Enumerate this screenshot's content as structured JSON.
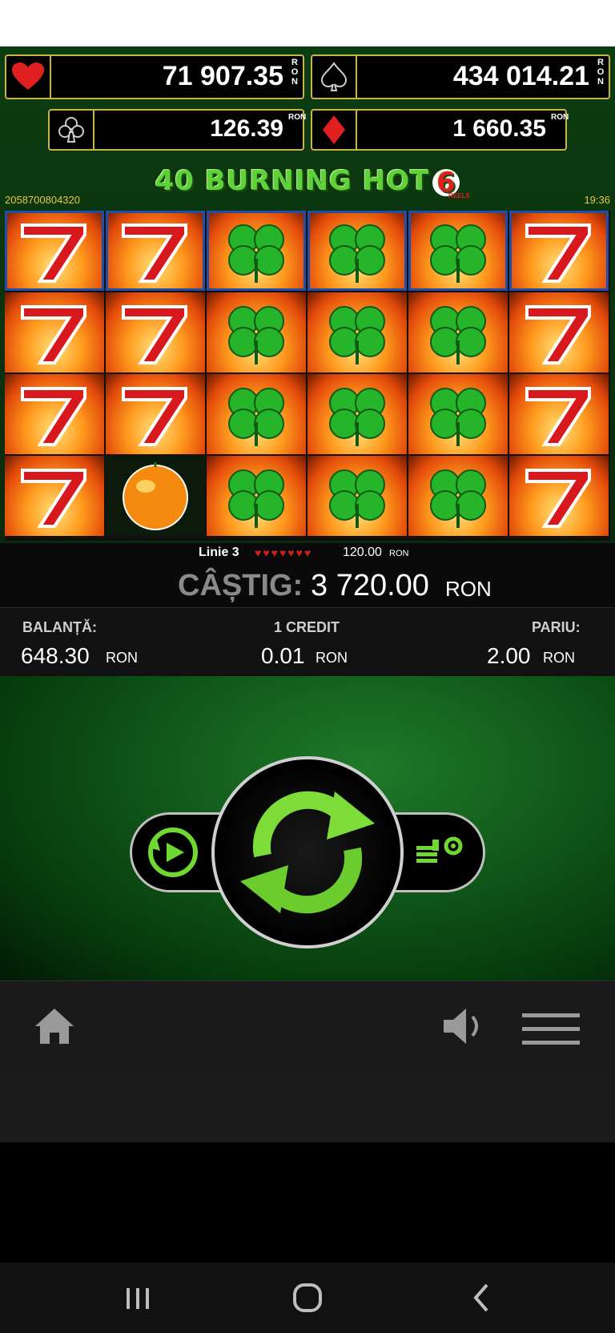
{
  "jackpots": {
    "hearts": {
      "amount": "71 907.35",
      "currency": "RON",
      "icon": "heart-icon"
    },
    "spades": {
      "amount": "434 014.21",
      "currency": "RON",
      "icon": "spade-icon"
    },
    "clubs": {
      "amount": "126.39",
      "currency": "RON",
      "icon": "club-icon"
    },
    "diamonds": {
      "amount": "1 660.35",
      "currency": "RON",
      "icon": "diamond-icon"
    }
  },
  "game": {
    "title": "40 BURNING HOT",
    "badge": "6",
    "badge_sub": "REELS",
    "session_id": "2058700804320",
    "clock": "19:36"
  },
  "reels": [
    [
      "seven",
      "seven",
      "seven",
      "seven"
    ],
    [
      "seven",
      "seven",
      "seven",
      "orange"
    ],
    [
      "clover",
      "clover",
      "clover",
      "clover"
    ],
    [
      "clover",
      "clover",
      "clover",
      "clover"
    ],
    [
      "clover",
      "clover",
      "clover",
      "clover"
    ],
    [
      "seven",
      "seven",
      "seven",
      "seven"
    ]
  ],
  "win_line": {
    "label": "Linie 3",
    "amount": "120.00",
    "currency": "RON"
  },
  "win": {
    "label": "CÂȘTIG:",
    "amount": "3 720.00",
    "currency": "RON"
  },
  "info": {
    "balance_label": "BALANȚĂ:",
    "balance_value": "648.30",
    "balance_currency": "RON",
    "credit_label": "1 CREDIT",
    "credit_value": "0.01",
    "credit_currency": "RON",
    "bet_label": "PARIU:",
    "bet_value": "2.00",
    "bet_currency": "RON"
  },
  "controls": {
    "autoplay_icon": "autoplay-icon",
    "spin_icon": "spin-arrows-icon",
    "settings_icon": "bet-settings-icon"
  },
  "toolbar": {
    "home_icon": "home-icon",
    "sound_icon": "speaker-icon",
    "menu_icon": "hamburger-menu-icon"
  },
  "android_nav": {
    "recents_icon": "recents-icon",
    "home_icon": "home-circle-icon",
    "back_icon": "back-icon"
  },
  "colors": {
    "win_green": "#5fd23a",
    "frame_gold": "#c8b44a",
    "line_blue": "#1f4fa8",
    "accent_red": "#e02020"
  }
}
